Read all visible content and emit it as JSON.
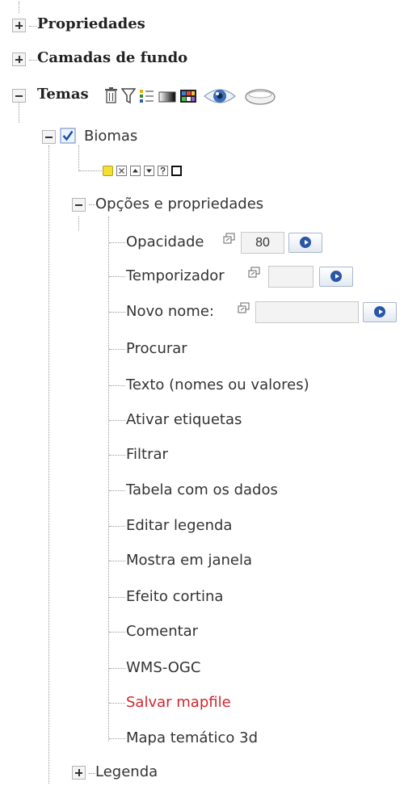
{
  "tree": {
    "properties_label": "Propriedades",
    "background_layers_label": "Camadas de fundo",
    "themes_label": "Temas",
    "layer": {
      "name": "Biomas",
      "checked": true,
      "options_label": "Opções e propriedades",
      "opacity_label": "Opacidade",
      "opacity_value": "80",
      "timer_label": "Temporizador",
      "timer_value": "",
      "rename_label": "Novo nome:",
      "rename_value": "",
      "items": [
        "Procurar",
        "Texto (nomes ou valores)",
        "Ativar etiquetas",
        "Filtrar",
        "Tabela com os dados",
        "Editar legenda",
        "Mostra em janela",
        "Efeito cortina",
        "Comentar",
        "WMS-OGC",
        "Salvar mapfile",
        "Mapa temático 3d"
      ],
      "highlight_color": "#d2262d",
      "legend_label": "Legenda"
    }
  }
}
